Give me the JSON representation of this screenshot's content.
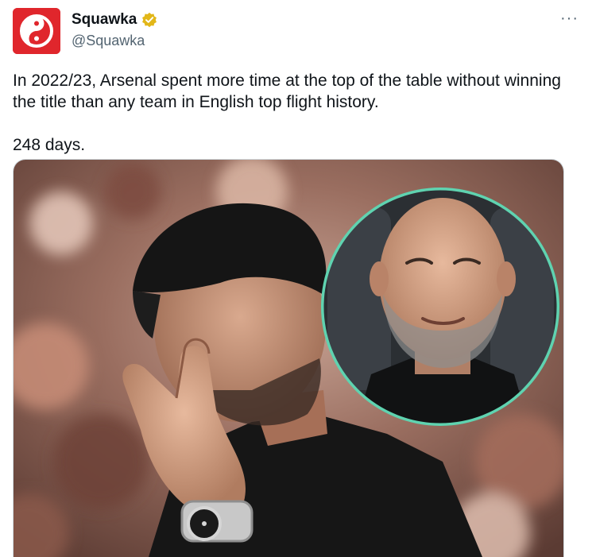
{
  "tweet": {
    "author": {
      "name": "Squawka",
      "handle": "@Squawka",
      "verified_badge": "gold-check-icon",
      "avatar_icon": "squawka-logo-icon",
      "brand_color": "#e0262c"
    },
    "more_label": "···",
    "text_lines": [
      "In 2022/23, Arsenal spent more time at the top of the table without winning the title than any team in English top flight history.",
      "248 days."
    ],
    "media": {
      "type": "photo",
      "ring_color": "#5fd3b0"
    }
  }
}
